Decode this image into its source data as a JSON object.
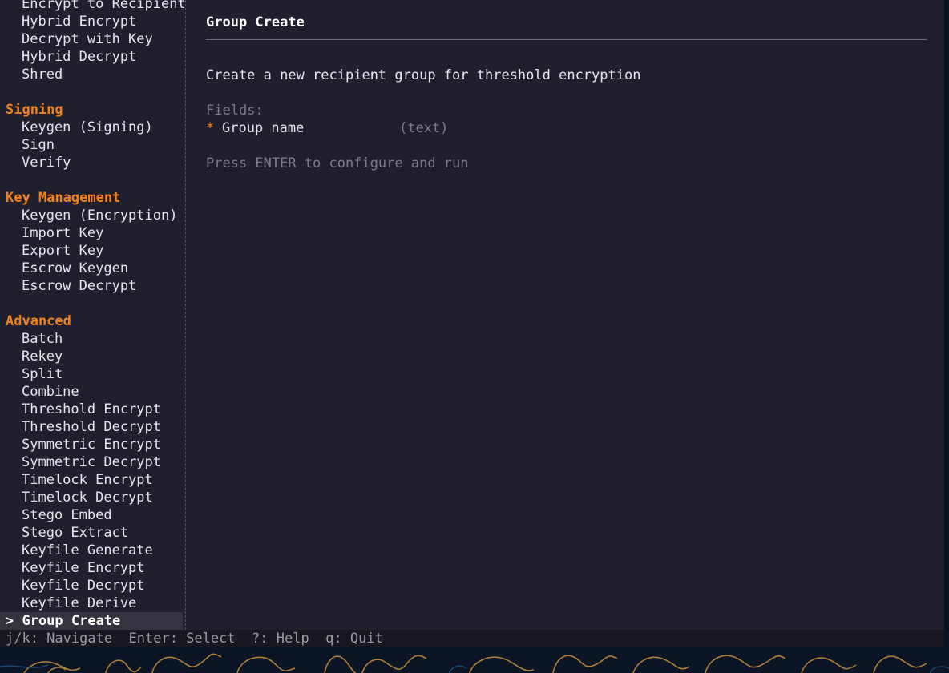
{
  "sidebar": {
    "rows": [
      {
        "type": "item",
        "label": "Encrypt to Recipient"
      },
      {
        "type": "item",
        "label": "Hybrid Encrypt"
      },
      {
        "type": "item",
        "label": "Decrypt with Key"
      },
      {
        "type": "item",
        "label": "Hybrid Decrypt"
      },
      {
        "type": "item",
        "label": "Shred"
      },
      {
        "type": "blank",
        "label": ""
      },
      {
        "type": "header",
        "label": "Signing"
      },
      {
        "type": "item",
        "label": "Keygen (Signing)"
      },
      {
        "type": "item",
        "label": "Sign"
      },
      {
        "type": "item",
        "label": "Verify"
      },
      {
        "type": "blank",
        "label": ""
      },
      {
        "type": "header",
        "label": "Key Management"
      },
      {
        "type": "item",
        "label": "Keygen (Encryption)"
      },
      {
        "type": "item",
        "label": "Import Key"
      },
      {
        "type": "item",
        "label": "Export Key"
      },
      {
        "type": "item",
        "label": "Escrow Keygen"
      },
      {
        "type": "item",
        "label": "Escrow Decrypt"
      },
      {
        "type": "blank",
        "label": ""
      },
      {
        "type": "header",
        "label": "Advanced"
      },
      {
        "type": "item",
        "label": "Batch"
      },
      {
        "type": "item",
        "label": "Rekey"
      },
      {
        "type": "item",
        "label": "Split"
      },
      {
        "type": "item",
        "label": "Combine"
      },
      {
        "type": "item",
        "label": "Threshold Encrypt"
      },
      {
        "type": "item",
        "label": "Threshold Decrypt"
      },
      {
        "type": "item",
        "label": "Symmetric Encrypt"
      },
      {
        "type": "item",
        "label": "Symmetric Decrypt"
      },
      {
        "type": "item",
        "label": "Timelock Encrypt"
      },
      {
        "type": "item",
        "label": "Timelock Decrypt"
      },
      {
        "type": "item",
        "label": "Stego Embed"
      },
      {
        "type": "item",
        "label": "Stego Extract"
      },
      {
        "type": "item",
        "label": "Keyfile Generate"
      },
      {
        "type": "item",
        "label": "Keyfile Encrypt"
      },
      {
        "type": "item",
        "label": "Keyfile Decrypt"
      },
      {
        "type": "item",
        "label": "Keyfile Derive"
      },
      {
        "type": "selected",
        "label": "> Group Create"
      }
    ]
  },
  "main": {
    "title": "Group Create",
    "description": "Create a new recipient group for threshold encryption",
    "fields_label": "Fields:",
    "fields": [
      {
        "required_marker": "*",
        "name": "Group name",
        "type": "(text)"
      }
    ],
    "hint": "Press ENTER to configure and run"
  },
  "statusbar": {
    "text": "j/k: Navigate  Enter: Select  ?: Help  q: Quit"
  },
  "colors": {
    "accent": "#f2811c",
    "background": "#1f1f2d",
    "text": "#e6e6ec",
    "muted": "#7c7c88",
    "selection": "#33343f"
  }
}
